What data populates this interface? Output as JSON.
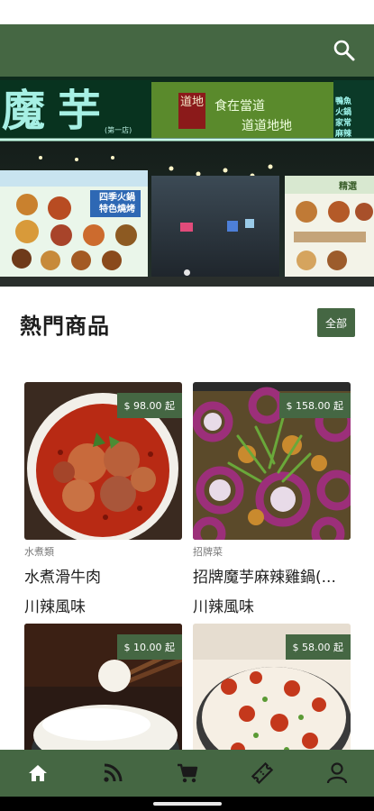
{
  "header": {
    "search_icon": "search-icon"
  },
  "hero": {
    "sign_left": "魔芋",
    "sign_left_small": "(第一店)",
    "sign_badge": "道地",
    "sign_mid_1": "食在當道",
    "sign_mid_2": "道道地地",
    "sign_right": "鴨魚\n火鍋\n家常\n麻辣",
    "banner_left_title": "四季火鍋\n特色燒烤",
    "banner_right_title": "精選"
  },
  "section": {
    "title": "熱門商品",
    "all_button": "全部"
  },
  "products": [
    {
      "price": "$ 98.00 起",
      "category": "水煮類",
      "name": "水煮滑牛肉",
      "tag": "川辣風味"
    },
    {
      "price": "$ 158.00 起",
      "category": "招牌菜",
      "name": "招牌魔芋麻辣雞鍋(...",
      "tag": "川辣風味"
    },
    {
      "price": "$ 10.00 起",
      "category": "",
      "name": "",
      "tag": ""
    },
    {
      "price": "$ 58.00 起",
      "category": "",
      "name": "",
      "tag": ""
    }
  ],
  "nav": {
    "items": [
      "home-icon",
      "rss-icon",
      "cart-icon",
      "ticket-icon",
      "profile-icon"
    ]
  },
  "colors": {
    "brand": "#456743",
    "gesture": "#000000"
  }
}
